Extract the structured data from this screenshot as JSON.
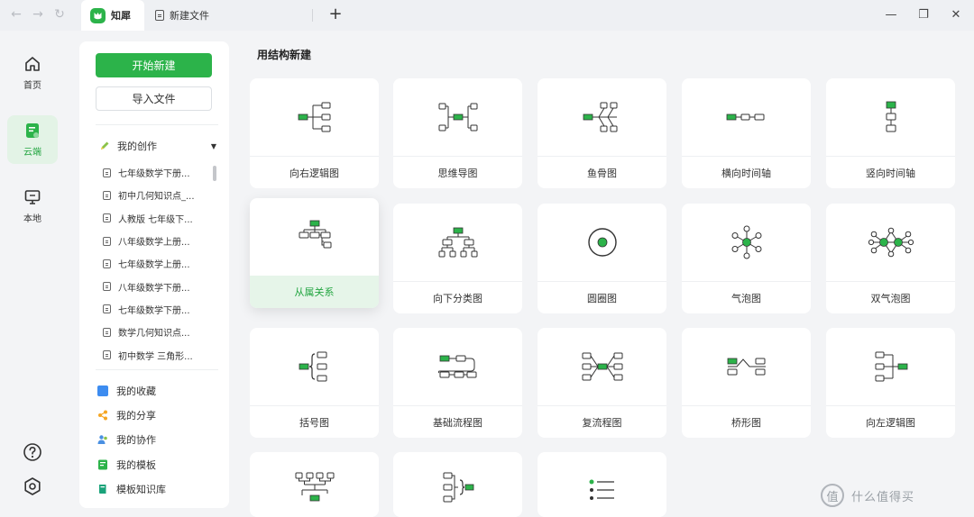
{
  "titlebar": {
    "app_tab_label": "知犀",
    "file_tab_label": "新建文件",
    "new_tab_glyph": "+",
    "back_glyph": "←",
    "forward_glyph": "→",
    "refresh_glyph": "↻",
    "minimize_glyph": "—",
    "maximize_glyph": "❐",
    "close_glyph": "✕"
  },
  "rail": {
    "items": [
      {
        "label": "首页",
        "icon": "home-icon"
      },
      {
        "label": "云端",
        "icon": "cloud-doc-icon"
      },
      {
        "label": "本地",
        "icon": "monitor-icon"
      }
    ],
    "bottom_icons": [
      "help-icon",
      "settings-icon"
    ]
  },
  "panel": {
    "new_button": "开始新建",
    "import_button": "导入文件",
    "my_creations": "我的创作",
    "documents": [
      "七年级数学下册...",
      "初中几何知识点_...",
      "人教版 七年级下...",
      "八年级数学上册...",
      "七年级数学上册...",
      "八年级数学下册...",
      "七年级数学下册...",
      "数学几何知识点...",
      "初中数学 三角形..."
    ],
    "nav": [
      {
        "label": "我的收藏",
        "color": "#3d8cf0"
      },
      {
        "label": "我的分享",
        "color": "#f5a623"
      },
      {
        "label": "我的协作",
        "color": "#4a90e2"
      },
      {
        "label": "我的模板",
        "color": "#2cb34a"
      },
      {
        "label": "模板知识库",
        "color": "#1aa37a"
      }
    ]
  },
  "main": {
    "section_title": "用结构新建",
    "templates": [
      "向右逻辑图",
      "思维导图",
      "鱼骨图",
      "横向时间轴",
      "竖向时间轴",
      "从属关系",
      "向下分类图",
      "圆圈图",
      "气泡图",
      "双气泡图",
      "括号图",
      "基础流程图",
      "复流程图",
      "桥形图",
      "向左逻辑图",
      "",
      "",
      ""
    ]
  },
  "watermark": {
    "text": "什么值得买",
    "glyph": "值"
  },
  "colors": {
    "accent": "#2cb34a",
    "accent_light": "#e6f5e9",
    "background": "#f3f4f6",
    "card": "#ffffff"
  }
}
